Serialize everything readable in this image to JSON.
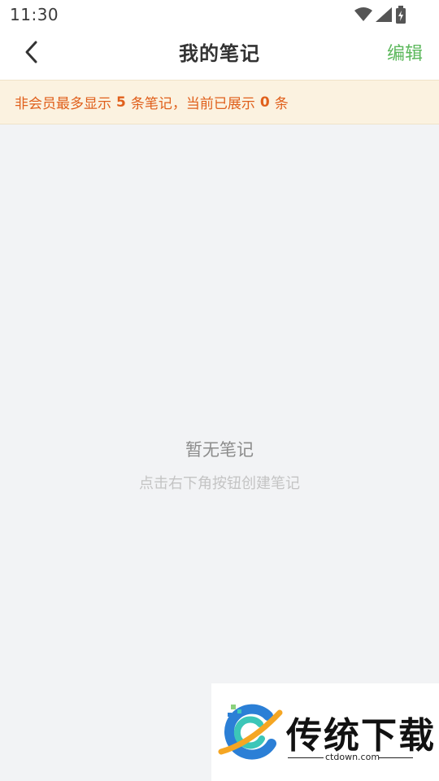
{
  "status_bar": {
    "time": "11:30",
    "icons": [
      "wifi-icon",
      "cell-signal-icon",
      "battery-charging-icon"
    ]
  },
  "nav": {
    "back_icon": "chevron-left-icon",
    "title": "我的笔记",
    "edit_label": "编辑"
  },
  "notice": {
    "prefix": "非会员最多显示",
    "max_count": "5",
    "middle": "条笔记，当前已展示",
    "shown_count": "0",
    "suffix": "条"
  },
  "empty_state": {
    "title": "暂无笔记",
    "hint": "点击右下角按钮创建笔记"
  },
  "watermark": {
    "brand": "传统下载",
    "domain": "ctdown.com"
  },
  "colors": {
    "accent_green": "#5cb85c",
    "notice_text": "#e0601c",
    "notice_bg": "#fbf2e0",
    "page_bg": "#f2f3f5"
  }
}
